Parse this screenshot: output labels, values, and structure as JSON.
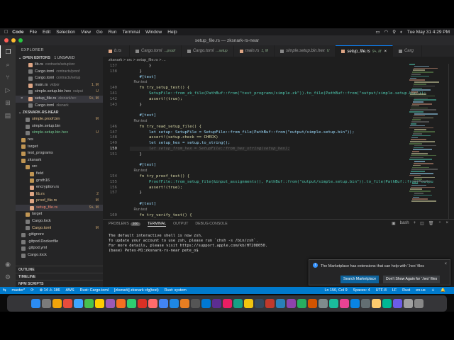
{
  "menubar": {
    "app": "Code",
    "items": [
      "File",
      "Edit",
      "Selection",
      "View",
      "Go",
      "Run",
      "Terminal",
      "Window",
      "Help"
    ],
    "datetime": "Tue May 31  4:29 PM"
  },
  "window": {
    "title": "setup_file.rs — zksnark-rs-near"
  },
  "sidebar": {
    "title": "EXPLORER",
    "open_editors": {
      "label": "OPEN EDITORS",
      "badge": "1 UNSAVED"
    },
    "open_files": [
      {
        "name": "lib.rs",
        "desc": "contracts/setup/src",
        "status": "",
        "color": "#dea584"
      },
      {
        "name": "Cargo.toml",
        "desc": "contracts/proof",
        "status": "",
        "color": "#7a7a7a"
      },
      {
        "name": "Cargo.toml",
        "desc": "contracts/setup",
        "status": "",
        "color": "#7a7a7a"
      },
      {
        "name": "main.rs",
        "desc": "vidpor",
        "status": "1, M",
        "color": "#dea584"
      },
      {
        "name": "simple.setup.bin.hex",
        "desc": "output",
        "status": "U",
        "color": "#7a7a7a"
      },
      {
        "name": "setup_file.rs",
        "desc": "zksnark/src",
        "status": "9+, M",
        "color": "#dea584"
      },
      {
        "name": "Cargo.toml",
        "desc": "zksnark",
        "status": "",
        "color": "#7a7a7a"
      }
    ],
    "project": "ZKSNARK-RS-NEAR",
    "tree": [
      {
        "name": "simple.proof.bin",
        "status": "M",
        "indent": 1,
        "color": "#7a7a7a"
      },
      {
        "name": "simple.setup.bin",
        "status": "",
        "indent": 1,
        "color": "#7a7a7a"
      },
      {
        "name": "simple.setup.bin.hex",
        "status": "U",
        "indent": 1,
        "color": "#7a7a7a"
      },
      {
        "name": "res",
        "status": "",
        "indent": 0,
        "color": "#c09553"
      },
      {
        "name": "target",
        "status": "",
        "indent": 0,
        "color": "#c09553"
      },
      {
        "name": "test_programs",
        "status": "",
        "indent": 0,
        "color": "#c09553"
      },
      {
        "name": "zksnark",
        "status": "",
        "indent": 0,
        "color": "#c09553"
      },
      {
        "name": "src",
        "status": "",
        "indent": 1,
        "color": "#c09553"
      },
      {
        "name": "field",
        "status": "",
        "indent": 2,
        "color": "#c09553"
      },
      {
        "name": "groth16",
        "status": "",
        "indent": 2,
        "color": "#c09553"
      },
      {
        "name": "encryption.rs",
        "status": "",
        "indent": 2,
        "color": "#dea584"
      },
      {
        "name": "lib.rs",
        "status": "2",
        "indent": 2,
        "color": "#dea584"
      },
      {
        "name": "proof_file.rs",
        "status": "M",
        "indent": 2,
        "color": "#dea584"
      },
      {
        "name": "setup_file.rs",
        "status": "9+, M",
        "indent": 2,
        "color": "#dea584"
      },
      {
        "name": "target",
        "status": "",
        "indent": 1,
        "color": "#c09553"
      },
      {
        "name": "Cargo.lock",
        "status": "",
        "indent": 1,
        "color": "#7a7a7a"
      },
      {
        "name": "Cargo.toml",
        "status": "M",
        "indent": 1,
        "color": "#7a7a7a"
      },
      {
        "name": ".gitignore",
        "status": "",
        "indent": 0,
        "color": "#7a7a7a"
      },
      {
        "name": ".gitpod.Dockerfile",
        "status": "",
        "indent": 0,
        "color": "#7a7a7a"
      },
      {
        "name": ".gitpod.yml",
        "status": "",
        "indent": 0,
        "color": "#7a7a7a"
      },
      {
        "name": "Cargo.lock",
        "status": "",
        "indent": 0,
        "color": "#7a7a7a"
      }
    ],
    "bottom": [
      "OUTLINE",
      "TIMELINE",
      "NPM SCRIPTS"
    ]
  },
  "tabs": [
    {
      "label": "b.rs",
      "suffix": "",
      "active": false
    },
    {
      "label": "Cargo.toml",
      "suffix": "...proof",
      "active": false
    },
    {
      "label": "Cargo.toml",
      "suffix": "...setup",
      "active": false
    },
    {
      "label": "main.rs",
      "suffix": "1, M",
      "active": false
    },
    {
      "label": "simple.setup.bin.hex",
      "suffix": "U",
      "active": false
    },
    {
      "label": "setup_file.rs",
      "suffix": "9+, M",
      "active": true
    },
    {
      "label": "Carg",
      "suffix": "",
      "active": false
    }
  ],
  "breadcrumb": "zksnark  >  src  >  setup_file.rs  >  ...",
  "code": [
    {
      "n": "137",
      "t": "        }"
    },
    {
      "n": "138",
      "t": "    }"
    },
    {
      "n": "",
      "t": "    #[test]"
    },
    {
      "n": "",
      "t": "    Run test"
    },
    {
      "n": "140",
      "t": "    fn try_setup_test() {"
    },
    {
      "n": "141",
      "t": "        SetupFile::from_zk_file(PathBuf::from(\"test_programs/simple.zk\")).to_file(PathBuf::from(\"output/simple.setup.bin\"));"
    },
    {
      "n": "142",
      "t": "        assert!(true);"
    },
    {
      "n": "143",
      "t": "    }"
    },
    {
      "n": "",
      "t": ""
    },
    {
      "n": "",
      "t": "    #[test]"
    },
    {
      "n": "",
      "t": "    Run test"
    },
    {
      "n": "146",
      "t": "    fn try_read_setup_file() {"
    },
    {
      "n": "147",
      "t": "        let setup: SetupFile = SetupFile::from_file(PathBuf::from(\"output/simple.setup.bin\"));"
    },
    {
      "n": "148",
      "t": "        assert!(setup.check == CHECK)"
    },
    {
      "n": "149",
      "t": "        let setup_hex = setup.to_string();"
    },
    {
      "n": "150",
      "t": "        let setup_from_hex = SetupFile::from_hex_string(setup_hex);"
    },
    {
      "n": "151",
      "t": "    }"
    },
    {
      "n": "",
      "t": ""
    },
    {
      "n": "",
      "t": "    #[test]"
    },
    {
      "n": "",
      "t": "    Run test"
    },
    {
      "n": "154",
      "t": "    fn try_proof_test() {"
    },
    {
      "n": "155",
      "t": "        ProofFile::from_setup_file(&input_assignments(), PathBuf::from(\"output/simple.setup.bin\")).to_file(PathBuf::from(\"outpu"
    },
    {
      "n": "156",
      "t": "        assert!(true);"
    },
    {
      "n": "157",
      "t": "    }"
    },
    {
      "n": "",
      "t": ""
    },
    {
      "n": "",
      "t": "    #[test]"
    },
    {
      "n": "",
      "t": "    Run test"
    },
    {
      "n": "160",
      "t": "    fn try_verify_test() {"
    }
  ],
  "panel": {
    "tabs": [
      "PROBLEMS",
      "TERMINAL",
      "OUTPUT",
      "DEBUG CONSOLE"
    ],
    "problems_count": "200",
    "shell": "bash",
    "terminal_lines": [
      "",
      "The default interactive shell is now zsh.",
      "To update your account to use zsh, please run `chsh -s /bin/zsh`.",
      "For more details, please visit https://support.apple.com/kb/HT208050.",
      "(base) Petes-M1:zksnark-rs-near pete_o$ "
    ]
  },
  "notification": {
    "text": "The Marketplace has extensions that can help with '.hex' files",
    "primary": "Search Marketplace",
    "secondary": "Don't Show Again for '.hex' files"
  },
  "statusbar": {
    "branch": "master*",
    "problems": "⊗ 14 ⚠ 186",
    "items": [
      "AWS",
      "Rust: Cargo.toml",
      "[zksnark] zksnark cfg(test)",
      "Rust: system"
    ],
    "right": [
      "Ln 150, Col 9",
      "Spaces: 4",
      "UTF-8",
      "LF",
      "Rust",
      "en-us"
    ]
  },
  "colors": {
    "accent": "#007acc",
    "button_blue": "#0e639c"
  }
}
